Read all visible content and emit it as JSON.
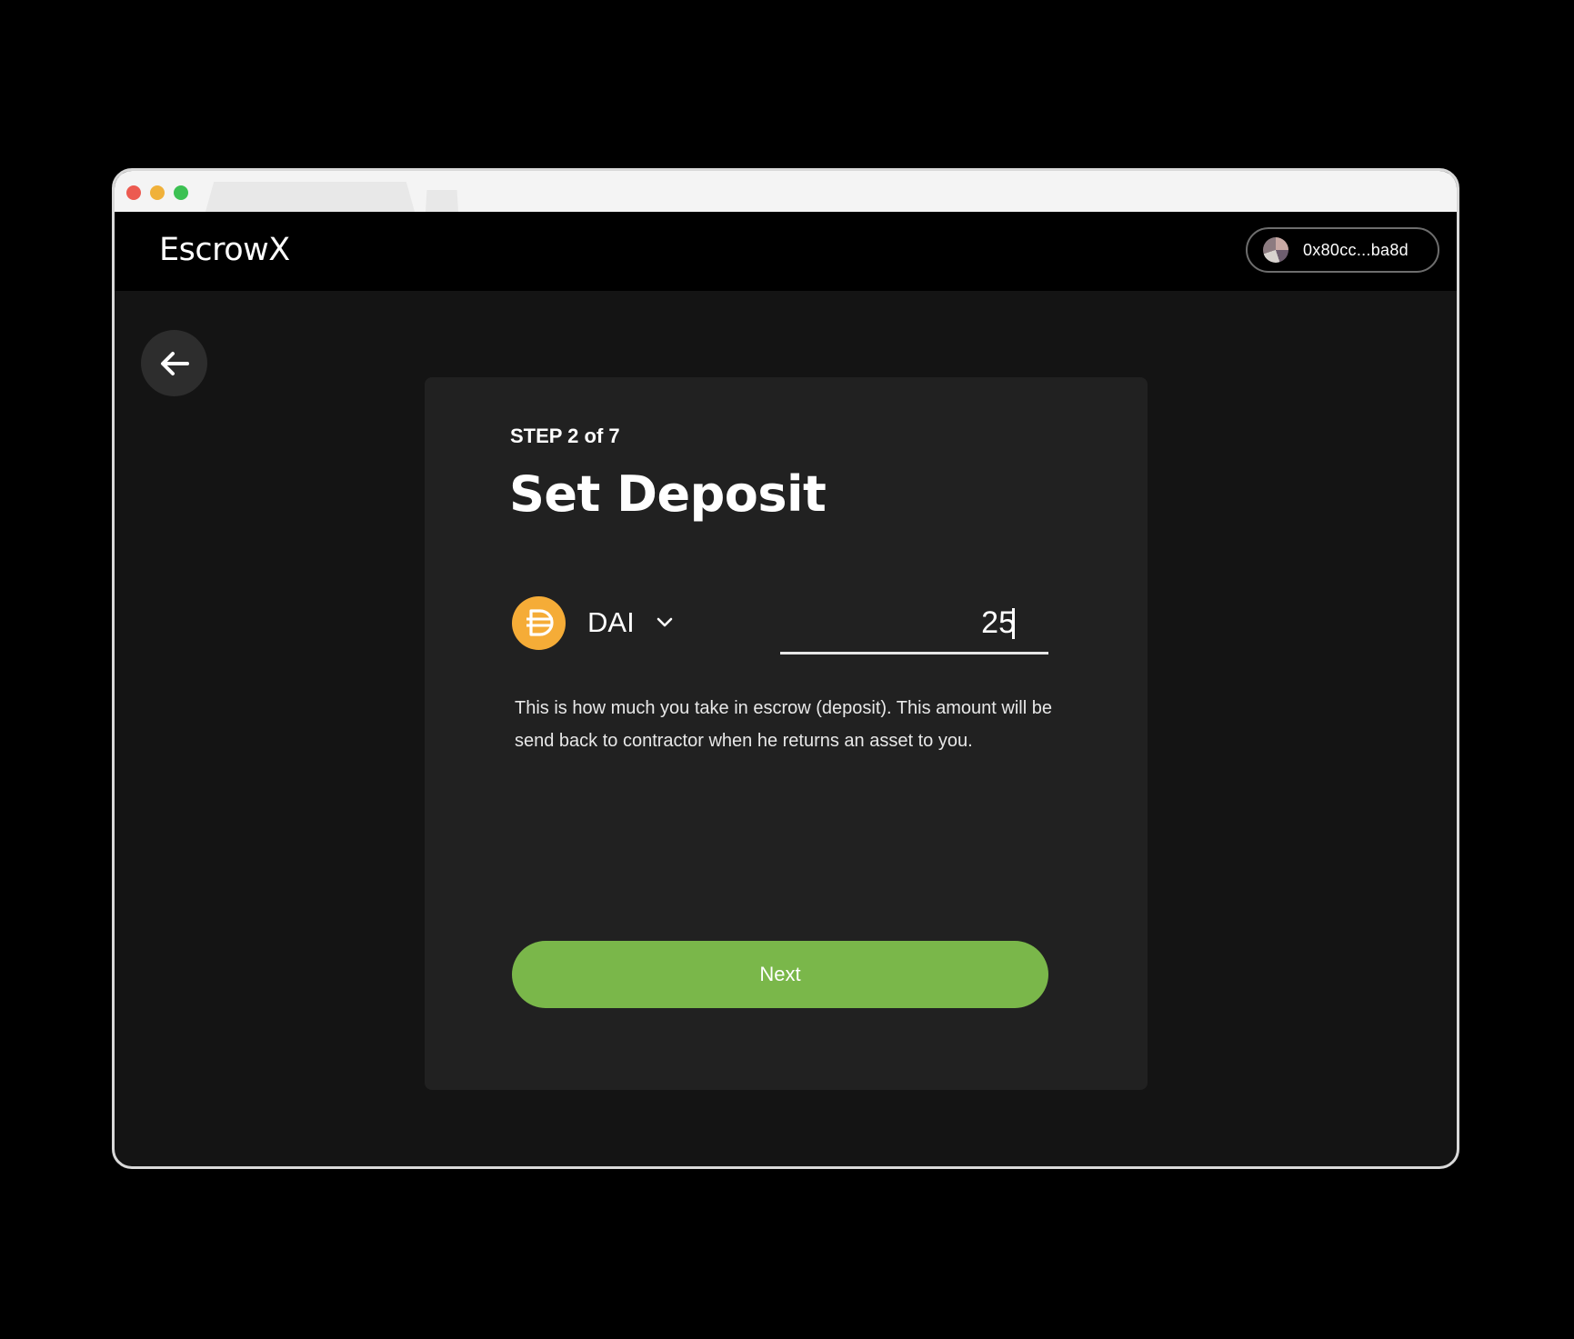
{
  "app": {
    "logo_text": "EscrowX"
  },
  "wallet": {
    "address": "0x80cc...ba8d"
  },
  "step": {
    "label": "STEP 2 of 7"
  },
  "page": {
    "title": "Set Deposit"
  },
  "deposit": {
    "token_name": "DAI",
    "token_icon": "dai-icon",
    "amount_value": "25",
    "description": "This is how much you take in escrow (deposit). This amount will be send back to contractor when he returns an asset to you."
  },
  "actions": {
    "next_label": "Next"
  },
  "colors": {
    "accent_green": "#7ab74a",
    "dai_yellow": "#f5ac37",
    "card_bg": "#212121",
    "page_bg": "#141414"
  },
  "icons": {
    "back": "arrow-left-icon",
    "chevron": "chevron-down-icon",
    "wallet_avatar": "wallet-avatar-icon"
  }
}
